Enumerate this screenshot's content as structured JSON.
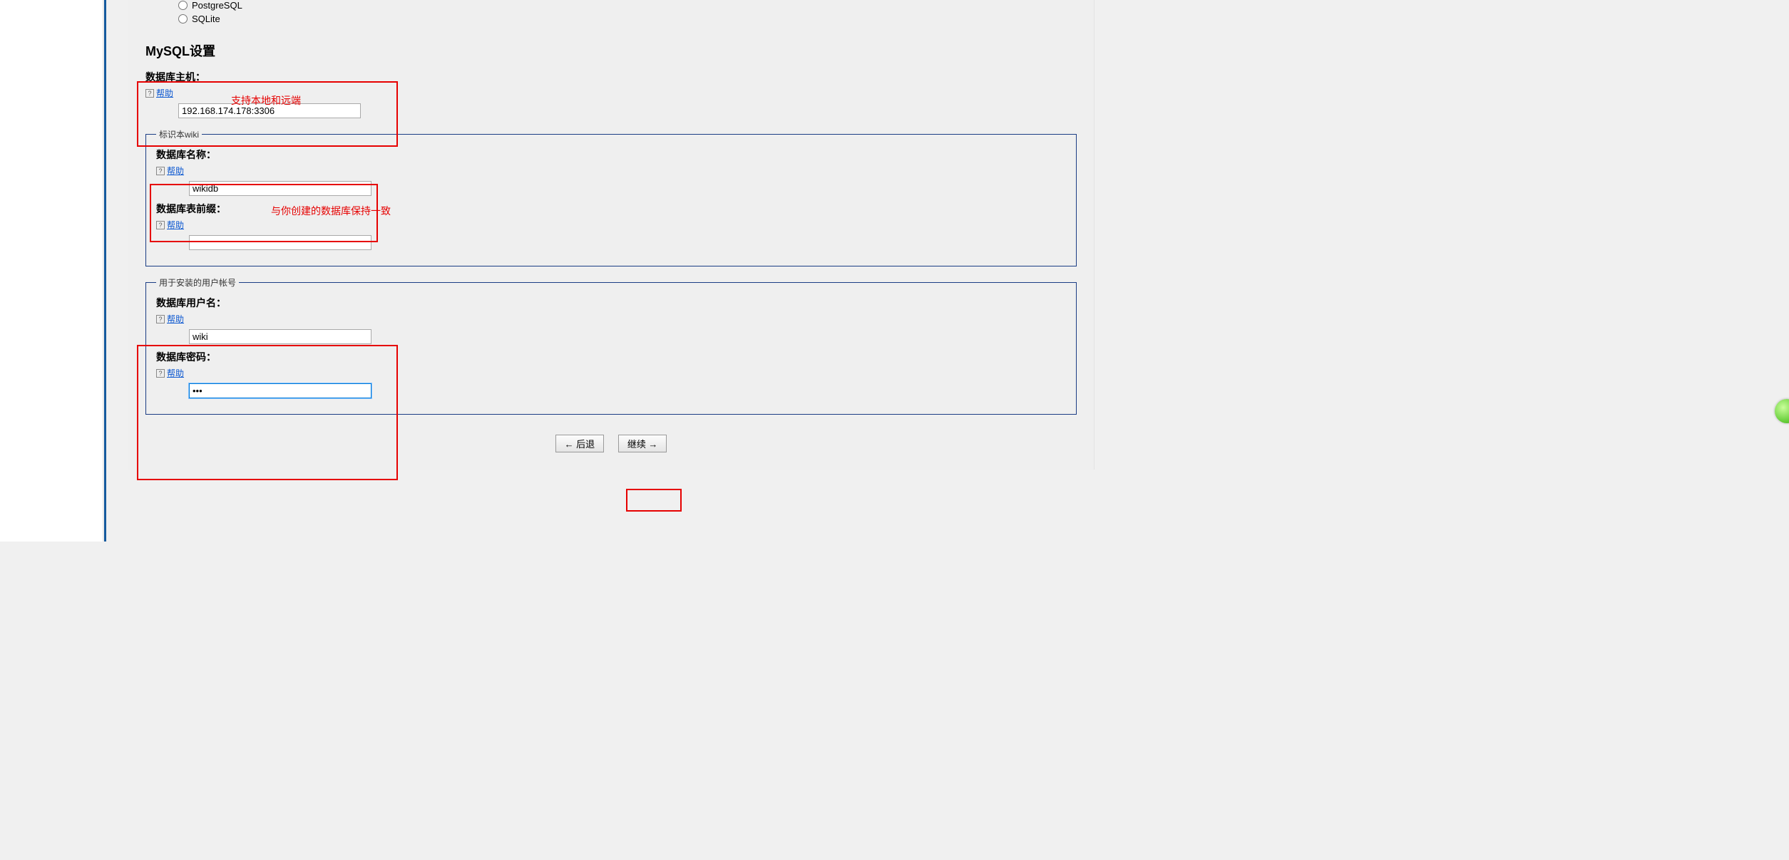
{
  "db_options": {
    "postgresql_label": "PostgreSQL",
    "sqlite_label": "SQLite"
  },
  "section_heading": "MySQL设置",
  "help_label": "帮助",
  "host": {
    "label": "数据库主机：",
    "value": "192.168.174.178:3306",
    "annotation": "支持本地和远端"
  },
  "fieldset1_legend": "标识本wiki",
  "dbname": {
    "label": "数据库名称：",
    "value": "wikidb",
    "annotation": "与你创建的数据库保持一致"
  },
  "prefix": {
    "label": "数据库表前缀：",
    "value": ""
  },
  "fieldset2_legend": "用于安装的用户帐号",
  "username": {
    "label": "数据库用户名：",
    "value": "wiki"
  },
  "password": {
    "label": "数据库密码：",
    "value": "•••"
  },
  "buttons": {
    "back": "← 后退",
    "next": "继续 →"
  }
}
